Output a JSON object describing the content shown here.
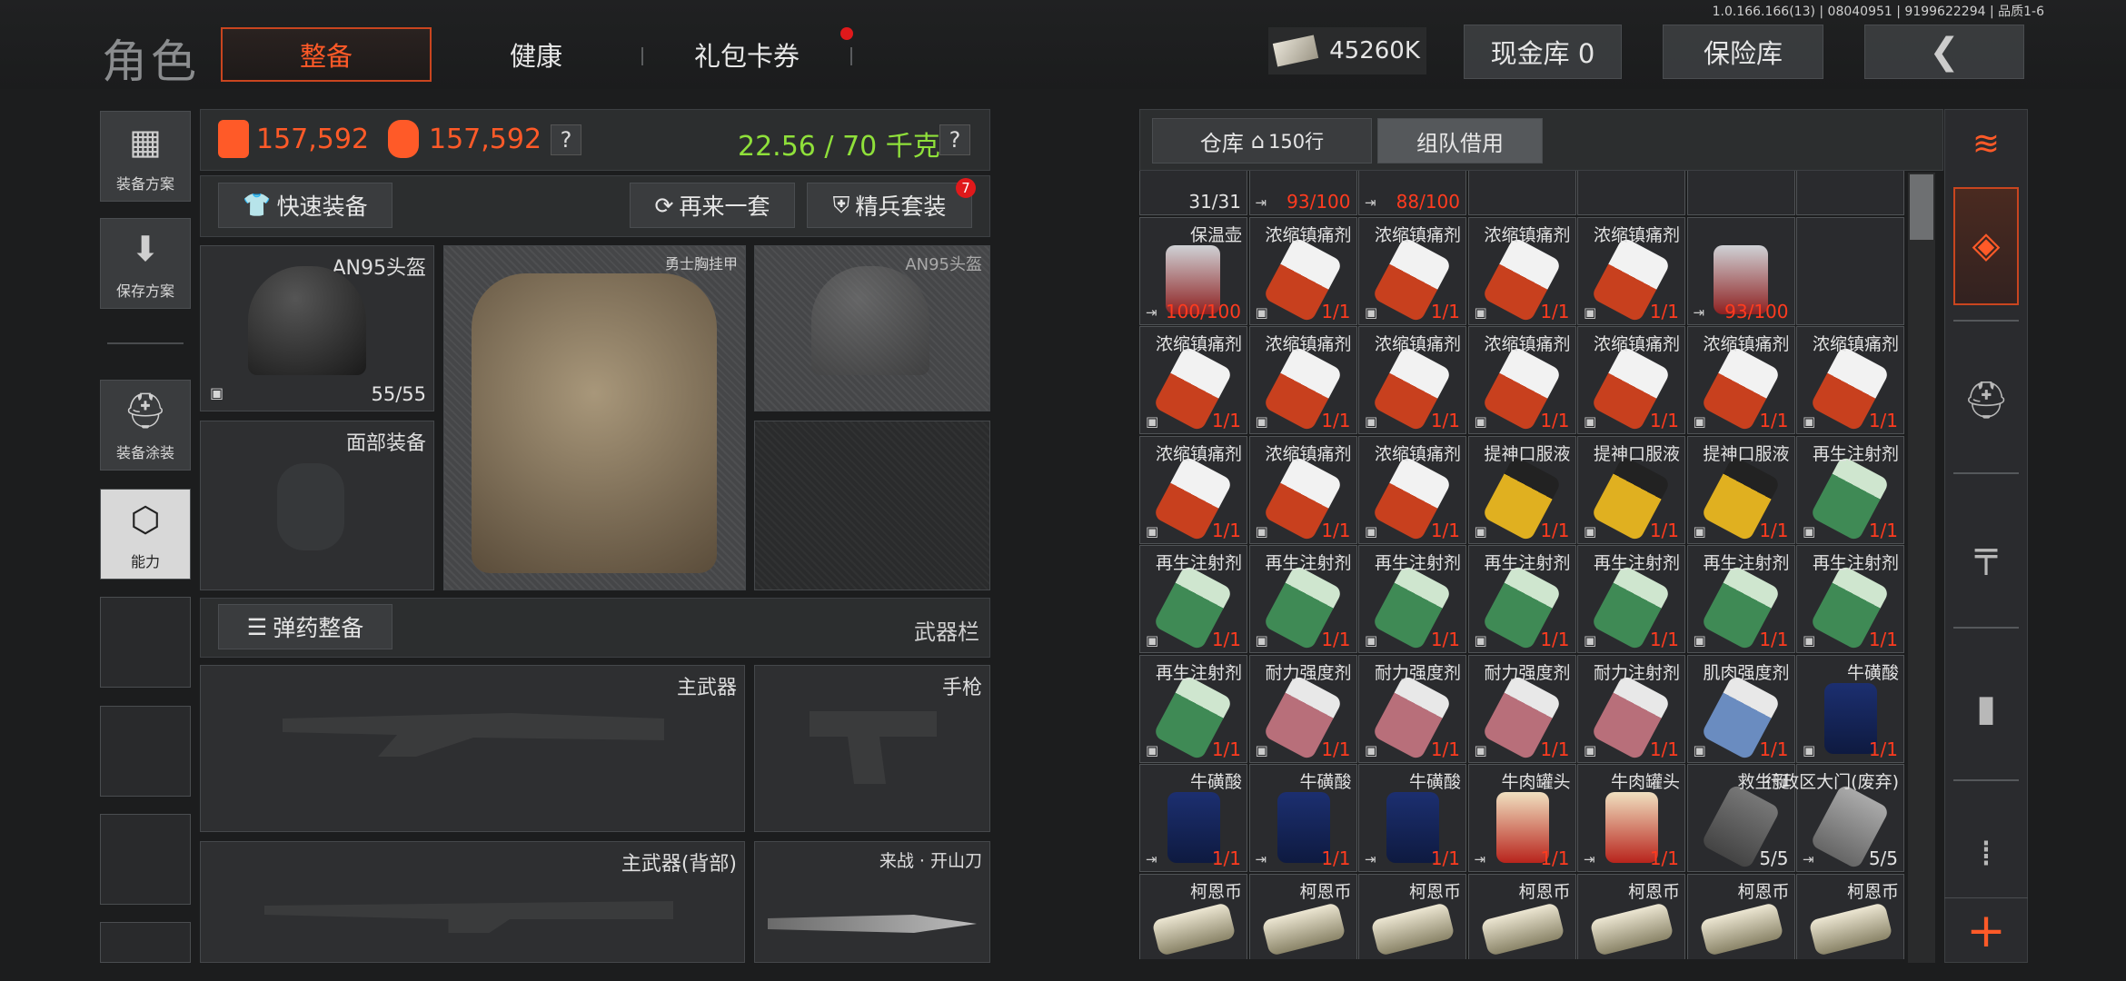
{
  "version": "1.0.166.166(13) | 08040951 | 9199622294 | 品质1-6",
  "header": {
    "title": "角色",
    "tabs": [
      "整备",
      "健康",
      "礼包卡券"
    ],
    "money": "45260K",
    "cash_vault": "现金库 0",
    "insurance": "保险库",
    "back": "❮"
  },
  "sidebar": [
    {
      "label": "装备方案",
      "icon": "vest-icon"
    },
    {
      "label": "保存方案",
      "icon": "download-icon"
    },
    {
      "label": "装备涂装",
      "icon": "helmet-paint-icon"
    },
    {
      "label": "能力",
      "icon": "ability-icon"
    }
  ],
  "stats": {
    "value1": "157,592",
    "value2": "157,592",
    "weight": "22.56 / 70 千克",
    "help": "?"
  },
  "buttons": {
    "quick_equip": "快速装备",
    "again": "再来一套",
    "elite": "精兵套装",
    "elite_badge": "7",
    "ammo": "弹药整备",
    "weapon_bar": "武器栏"
  },
  "gear": {
    "helmet": "AN95头盔",
    "helmet_dur": "55/55",
    "armor": "勇士胸挂甲",
    "helmet2": "AN95头盔",
    "face": "面部装备"
  },
  "weapons": {
    "primary": "主武器",
    "pistol": "手枪",
    "primary_back": "主武器(背部)",
    "melee": "来战 · 开山刀"
  },
  "warehouse": {
    "tab1": "仓库",
    "tab1_rows": "150行",
    "tab2": "组队借用"
  },
  "items": [
    [
      "",
      "31/31",
      "",
      ""
    ],
    [
      "",
      "93/100",
      "exit",
      ""
    ],
    [
      "",
      "88/100",
      "exit",
      ""
    ],
    [
      "",
      "",
      "",
      ""
    ],
    [
      "",
      "",
      "",
      ""
    ],
    [
      "",
      "",
      "",
      ""
    ],
    [
      "",
      "",
      "",
      ""
    ],
    [
      "保温壶",
      "100/100",
      "exit",
      "thermos"
    ],
    [
      "浓缩镇痛剂",
      "1/1",
      "box",
      "painkiller"
    ],
    [
      "浓缩镇痛剂",
      "1/1",
      "box",
      "painkiller"
    ],
    [
      "浓缩镇痛剂",
      "1/1",
      "box",
      "painkiller"
    ],
    [
      "浓缩镇痛剂",
      "1/1",
      "box",
      "painkiller"
    ],
    [
      "",
      "93/100",
      "exit",
      "thermos"
    ],
    [
      "",
      "",
      "",
      ""
    ],
    [
      "浓缩镇痛剂",
      "1/1",
      "box",
      "painkiller"
    ],
    [
      "浓缩镇痛剂",
      "1/1",
      "box",
      "painkiller"
    ],
    [
      "浓缩镇痛剂",
      "1/1",
      "box",
      "painkiller"
    ],
    [
      "浓缩镇痛剂",
      "1/1",
      "box",
      "painkiller"
    ],
    [
      "浓缩镇痛剂",
      "1/1",
      "box",
      "painkiller"
    ],
    [
      "浓缩镇痛剂",
      "1/1",
      "box",
      "painkiller"
    ],
    [
      "浓缩镇痛剂",
      "1/1",
      "box",
      "painkiller"
    ],
    [
      "浓缩镇痛剂",
      "1/1",
      "box",
      "painkiller"
    ],
    [
      "浓缩镇痛剂",
      "1/1",
      "box",
      "painkiller"
    ],
    [
      "浓缩镇痛剂",
      "1/1",
      "box",
      "painkiller"
    ],
    [
      "提神口服液",
      "1/1",
      "box",
      "oral"
    ],
    [
      "提神口服液",
      "1/1",
      "box",
      "oral"
    ],
    [
      "提神口服液",
      "1/1",
      "box",
      "oral"
    ],
    [
      "再生注射剂",
      "1/1",
      "box",
      "regen"
    ],
    [
      "再生注射剂",
      "1/1",
      "box",
      "regen"
    ],
    [
      "再生注射剂",
      "1/1",
      "box",
      "regen"
    ],
    [
      "再生注射剂",
      "1/1",
      "box",
      "regen"
    ],
    [
      "再生注射剂",
      "1/1",
      "box",
      "regen"
    ],
    [
      "再生注射剂",
      "1/1",
      "box",
      "regen"
    ],
    [
      "再生注射剂",
      "1/1",
      "box",
      "regen"
    ],
    [
      "再生注射剂",
      "1/1",
      "box",
      "regen"
    ],
    [
      "再生注射剂",
      "1/1",
      "box",
      "regen"
    ],
    [
      "耐力强度剂",
      "1/1",
      "box",
      "stamina"
    ],
    [
      "耐力强度剂",
      "1/1",
      "box",
      "stamina"
    ],
    [
      "耐力强度剂",
      "1/1",
      "box",
      "stamina"
    ],
    [
      "耐力注射剂",
      "1/1",
      "box",
      "stamina"
    ],
    [
      "肌肉强度剂",
      "1/1",
      "box",
      "muscle"
    ],
    [
      "牛磺酸",
      "1/1",
      "box",
      "can"
    ],
    [
      "牛磺酸",
      "1/1",
      "exit",
      "can"
    ],
    [
      "牛磺酸",
      "1/1",
      "exit",
      "can"
    ],
    [
      "牛磺酸",
      "1/1",
      "exit",
      "can"
    ],
    [
      "牛肉罐头",
      "1/1",
      "exit",
      "beef"
    ],
    [
      "牛肉罐头",
      "1/1",
      "exit",
      "beef"
    ],
    [
      "救生艇",
      "5/5",
      "",
      "boat"
    ],
    [
      "行政区大门(废弃)",
      "5/5",
      "exit",
      "key"
    ],
    [
      "柯恩币",
      "",
      "",
      "coin"
    ],
    [
      "柯恩币",
      "",
      "",
      "coin"
    ],
    [
      "柯恩币",
      "",
      "",
      "coin"
    ],
    [
      "柯恩币",
      "",
      "",
      "coin"
    ],
    [
      "柯恩币",
      "",
      "",
      "coin"
    ],
    [
      "柯恩币",
      "",
      "",
      "coin"
    ],
    [
      "柯恩币",
      "",
      "",
      "coin"
    ]
  ],
  "rightnav": [
    "layers-refresh-icon",
    "layers-icon",
    "helmet-icon",
    "rifle-icon",
    "magazine-icon",
    "ammo-icon",
    "plus-icon"
  ],
  "colors": {
    "accent": "#ff5a28",
    "green": "#8fe03a",
    "count_red": "#ff3b1f"
  }
}
